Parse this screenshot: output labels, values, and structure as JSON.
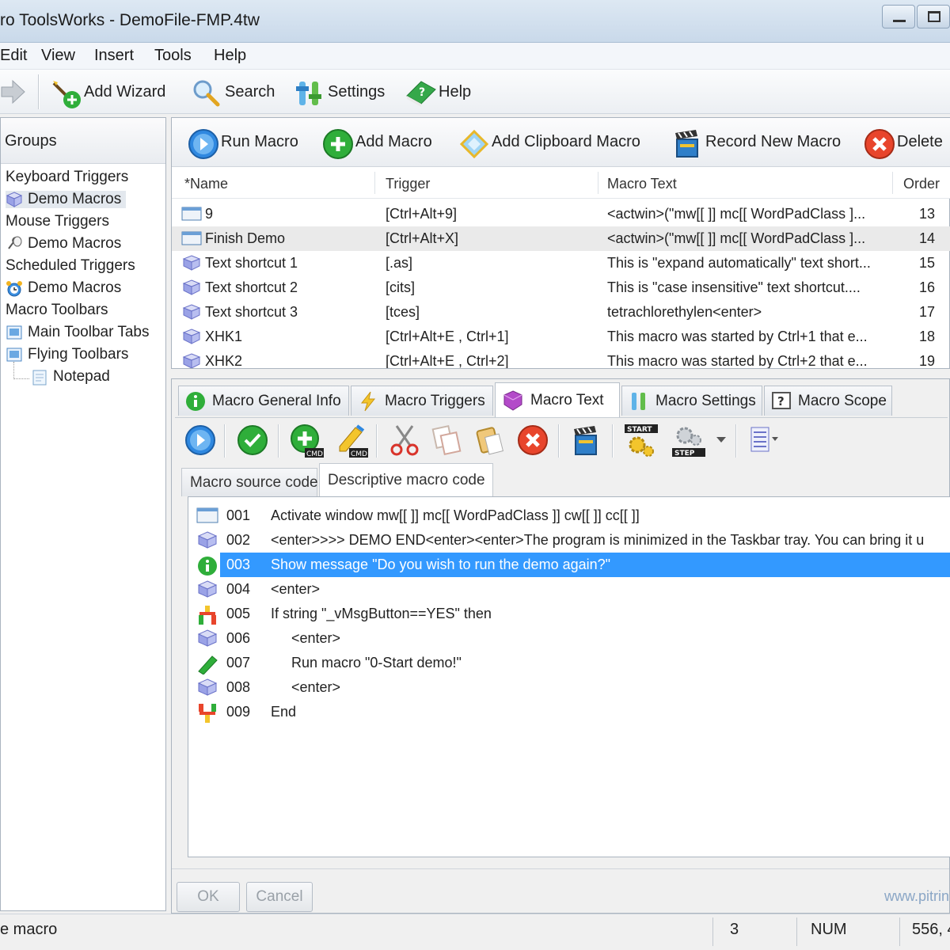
{
  "window": {
    "title": "ro ToolsWorks - DemoFile-FMP.4tw"
  },
  "menu": [
    "Edit",
    "View",
    "Insert",
    "Tools",
    "Help"
  ],
  "main_toolbar": {
    "add_wizard": "Add Wizard",
    "search": "Search",
    "settings": "Settings",
    "help": "Help"
  },
  "groups_panel": {
    "header": "Groups",
    "items": [
      {
        "label": "Keyboard Triggers",
        "level": 0,
        "icon": "none"
      },
      {
        "label": "Demo Macros",
        "level": 1,
        "icon": "cube-icon"
      },
      {
        "label": "Mouse Triggers",
        "level": 0,
        "icon": "none"
      },
      {
        "label": "Demo Macros",
        "level": 1,
        "icon": "mouse-icon"
      },
      {
        "label": "Scheduled Triggers",
        "level": 0,
        "icon": "none"
      },
      {
        "label": "Demo Macros",
        "level": 1,
        "icon": "alarm-clock-icon"
      },
      {
        "label": "Macro Toolbars",
        "level": 0,
        "icon": "none"
      },
      {
        "label": "Main Toolbar Tabs",
        "level": 1,
        "icon": "toolbar-icon"
      },
      {
        "label": "Flying Toolbars",
        "level": 1,
        "icon": "toolbar-icon"
      },
      {
        "label": "Notepad",
        "level": 2,
        "icon": "notepad-icon"
      }
    ]
  },
  "macro_toolbar": {
    "run_macro": "Run Macro",
    "add_macro": "Add Macro",
    "add_clipboard_macro": "Add Clipboard Macro",
    "record_new_macro": "Record New Macro",
    "delete": "Delete"
  },
  "macro_table": {
    "columns": [
      "*Name",
      "Trigger",
      "Macro Text",
      "Order"
    ],
    "rows": [
      {
        "name": "9",
        "trigger": "[Ctrl+Alt+9]",
        "text": "<actwin>(\"mw[[  ]] mc[[ WordPadClass ]...",
        "order": "13",
        "icon": "window-icon"
      },
      {
        "name": "Finish Demo",
        "trigger": "[Ctrl+Alt+X]",
        "text": "<actwin>(\"mw[[  ]] mc[[ WordPadClass ]...",
        "order": "14",
        "icon": "window-icon"
      },
      {
        "name": "Text shortcut 1",
        "trigger": "[.as]",
        "text": "This is \"expand automatically\" text short...",
        "order": "15",
        "icon": "cube-icon"
      },
      {
        "name": "Text shortcut 2",
        "trigger": "[cits]",
        "text": "This is \"case insensitive\" text shortcut....",
        "order": "16",
        "icon": "cube-icon"
      },
      {
        "name": "Text shortcut 3",
        "trigger": "[tces]",
        "text": "tetrachlorethylen<enter>",
        "order": "17",
        "icon": "cube-icon"
      },
      {
        "name": "XHK1",
        "trigger": "[Ctrl+Alt+E , Ctrl+1]",
        "text": "This macro was started by Ctrl+1 that e...",
        "order": "18",
        "icon": "cube-icon"
      },
      {
        "name": "XHK2",
        "trigger": "[Ctrl+Alt+E , Ctrl+2]",
        "text": "This macro was started by Ctrl+2 that e...",
        "order": "19",
        "icon": "cube-icon"
      }
    ]
  },
  "tabs": [
    {
      "label": "Macro General Info",
      "icon": "info-icon"
    },
    {
      "label": "Macro Triggers",
      "icon": "lightning-icon"
    },
    {
      "label": "Macro Text",
      "icon": "macro-text-icon"
    },
    {
      "label": "Macro Settings",
      "icon": "settings-icon"
    },
    {
      "label": "Macro Scope",
      "icon": "scope-icon"
    }
  ],
  "subtabs": {
    "source": "Macro source code",
    "descriptive": "Descriptive macro code"
  },
  "toolstrip": {
    "start_label": "START",
    "step_label": "STEP",
    "cmd_label": "CMD"
  },
  "code_lines": [
    {
      "num": "001",
      "text": "Activate window mw[[  ]] mc[[ WordPadClass ]] cw[[  ]] cc[[  ]]",
      "indent": 0,
      "icon": "window-icon"
    },
    {
      "num": "002",
      "text": "<enter>>>> DEMO END<enter><enter>The program is minimized in the Taskbar tray.  You can bring it u",
      "indent": 0,
      "icon": "cube-icon"
    },
    {
      "num": "003",
      "text": "Show message \"Do you wish to run the demo again?\"",
      "indent": 0,
      "icon": "message-icon"
    },
    {
      "num": "004",
      "text": "<enter>",
      "indent": 0,
      "icon": "cube-icon"
    },
    {
      "num": "005",
      "text": "If string \"_vMsgButton==YES\" then",
      "indent": 0,
      "icon": "if-branch-icon"
    },
    {
      "num": "006",
      "text": "<enter>",
      "indent": 1,
      "icon": "cube-icon"
    },
    {
      "num": "007",
      "text": "Run macro \"0-Start demo!\"",
      "indent": 1,
      "icon": "run-macro-icon"
    },
    {
      "num": "008",
      "text": "<enter>",
      "indent": 1,
      "icon": "cube-icon"
    },
    {
      "num": "009",
      "text": "End",
      "indent": 0,
      "icon": "end-branch-icon"
    }
  ],
  "dialog_buttons": {
    "ok": "OK",
    "cancel": "Cancel"
  },
  "footer_url": "www.pitrin",
  "statusbar": {
    "message": "e macro",
    "count": "3",
    "num": "NUM",
    "coords": "556, 4"
  },
  "colors": {
    "selection": "#3399ff",
    "title_bg": "#d3e1ef",
    "accent_green": "#2fae3a",
    "accent_red": "#e8452c",
    "accent_blue": "#2f88e0"
  }
}
